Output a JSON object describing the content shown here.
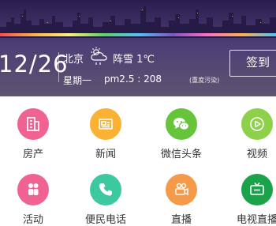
{
  "header": {
    "date": "12/26",
    "city": "北京",
    "weather": "阵雪 1℃",
    "weekday": "星期一",
    "pm25": "pm2.5 : 208",
    "pm_note": "(重度污染)",
    "signin_label": "签到",
    "weather_icon": "snow-cloud-icon"
  },
  "grid": {
    "items": [
      {
        "label": "房产",
        "icon": "building-icon",
        "color": "#f06292"
      },
      {
        "label": "新闻",
        "icon": "newspaper-icon",
        "color": "#f9b233"
      },
      {
        "label": "微信头条",
        "icon": "wechat-icon",
        "color": "#66c43a"
      },
      {
        "label": "视频",
        "icon": "play-icon",
        "color": "#8dd14a"
      },
      {
        "label": "活动",
        "icon": "people-icon",
        "color": "#f06292"
      },
      {
        "label": "便民电话",
        "icon": "phone-icon",
        "color": "#3cc9a0"
      },
      {
        "label": "直播",
        "icon": "camera-icon",
        "color": "#f59a48"
      },
      {
        "label": "电视直播",
        "icon": "tv-icon",
        "color": "#1aa34a"
      }
    ]
  }
}
